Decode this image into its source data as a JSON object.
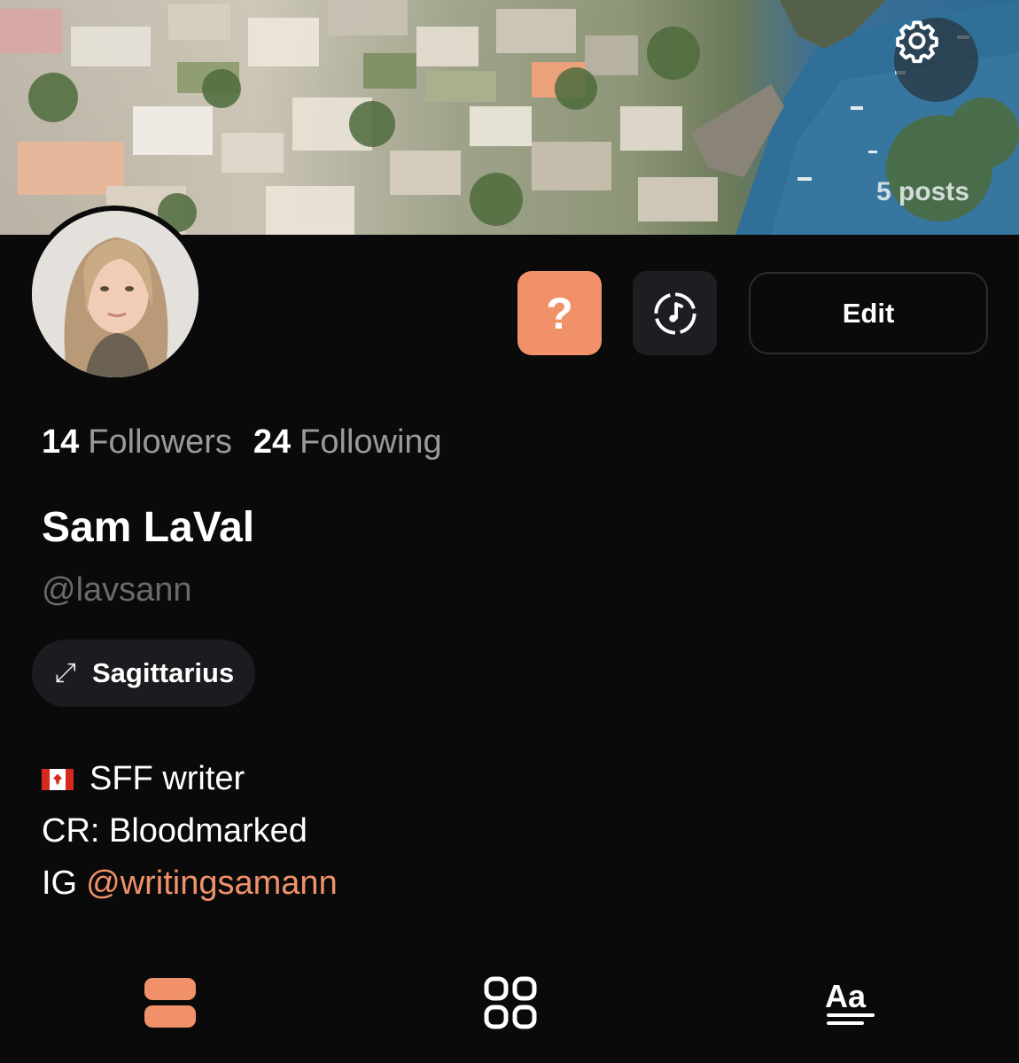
{
  "header": {
    "posts_count": "5 posts",
    "settings_icon": "gear-icon"
  },
  "actions": {
    "question_label": "?",
    "music_icon": "music-disc-icon",
    "edit_label": "Edit"
  },
  "profile": {
    "followers_count": "14",
    "followers_label": "Followers",
    "following_count": "24",
    "following_label": "Following",
    "name": "Sam LaVal",
    "handle": "@lavsann",
    "zodiac_symbol": "⤢",
    "zodiac_label": "Sagittarius"
  },
  "bio": {
    "line1_flag": "canada-flag",
    "line1_text": "SFF writer",
    "line2_text": "CR: Bloodmarked",
    "line3_prefix": "IG",
    "line3_link": "@writingsamann"
  },
  "tabs": [
    {
      "icon": "stacked-posts-icon",
      "active": true
    },
    {
      "icon": "grid-icon",
      "active": false
    },
    {
      "icon": "text-posts-icon",
      "active": false
    }
  ],
  "colors": {
    "accent": "#f0916a",
    "background": "#0a0a0b",
    "muted_text": "#9a9a9e",
    "handle_text": "#6a6a6e",
    "chip_bg": "#1b1c1f"
  }
}
